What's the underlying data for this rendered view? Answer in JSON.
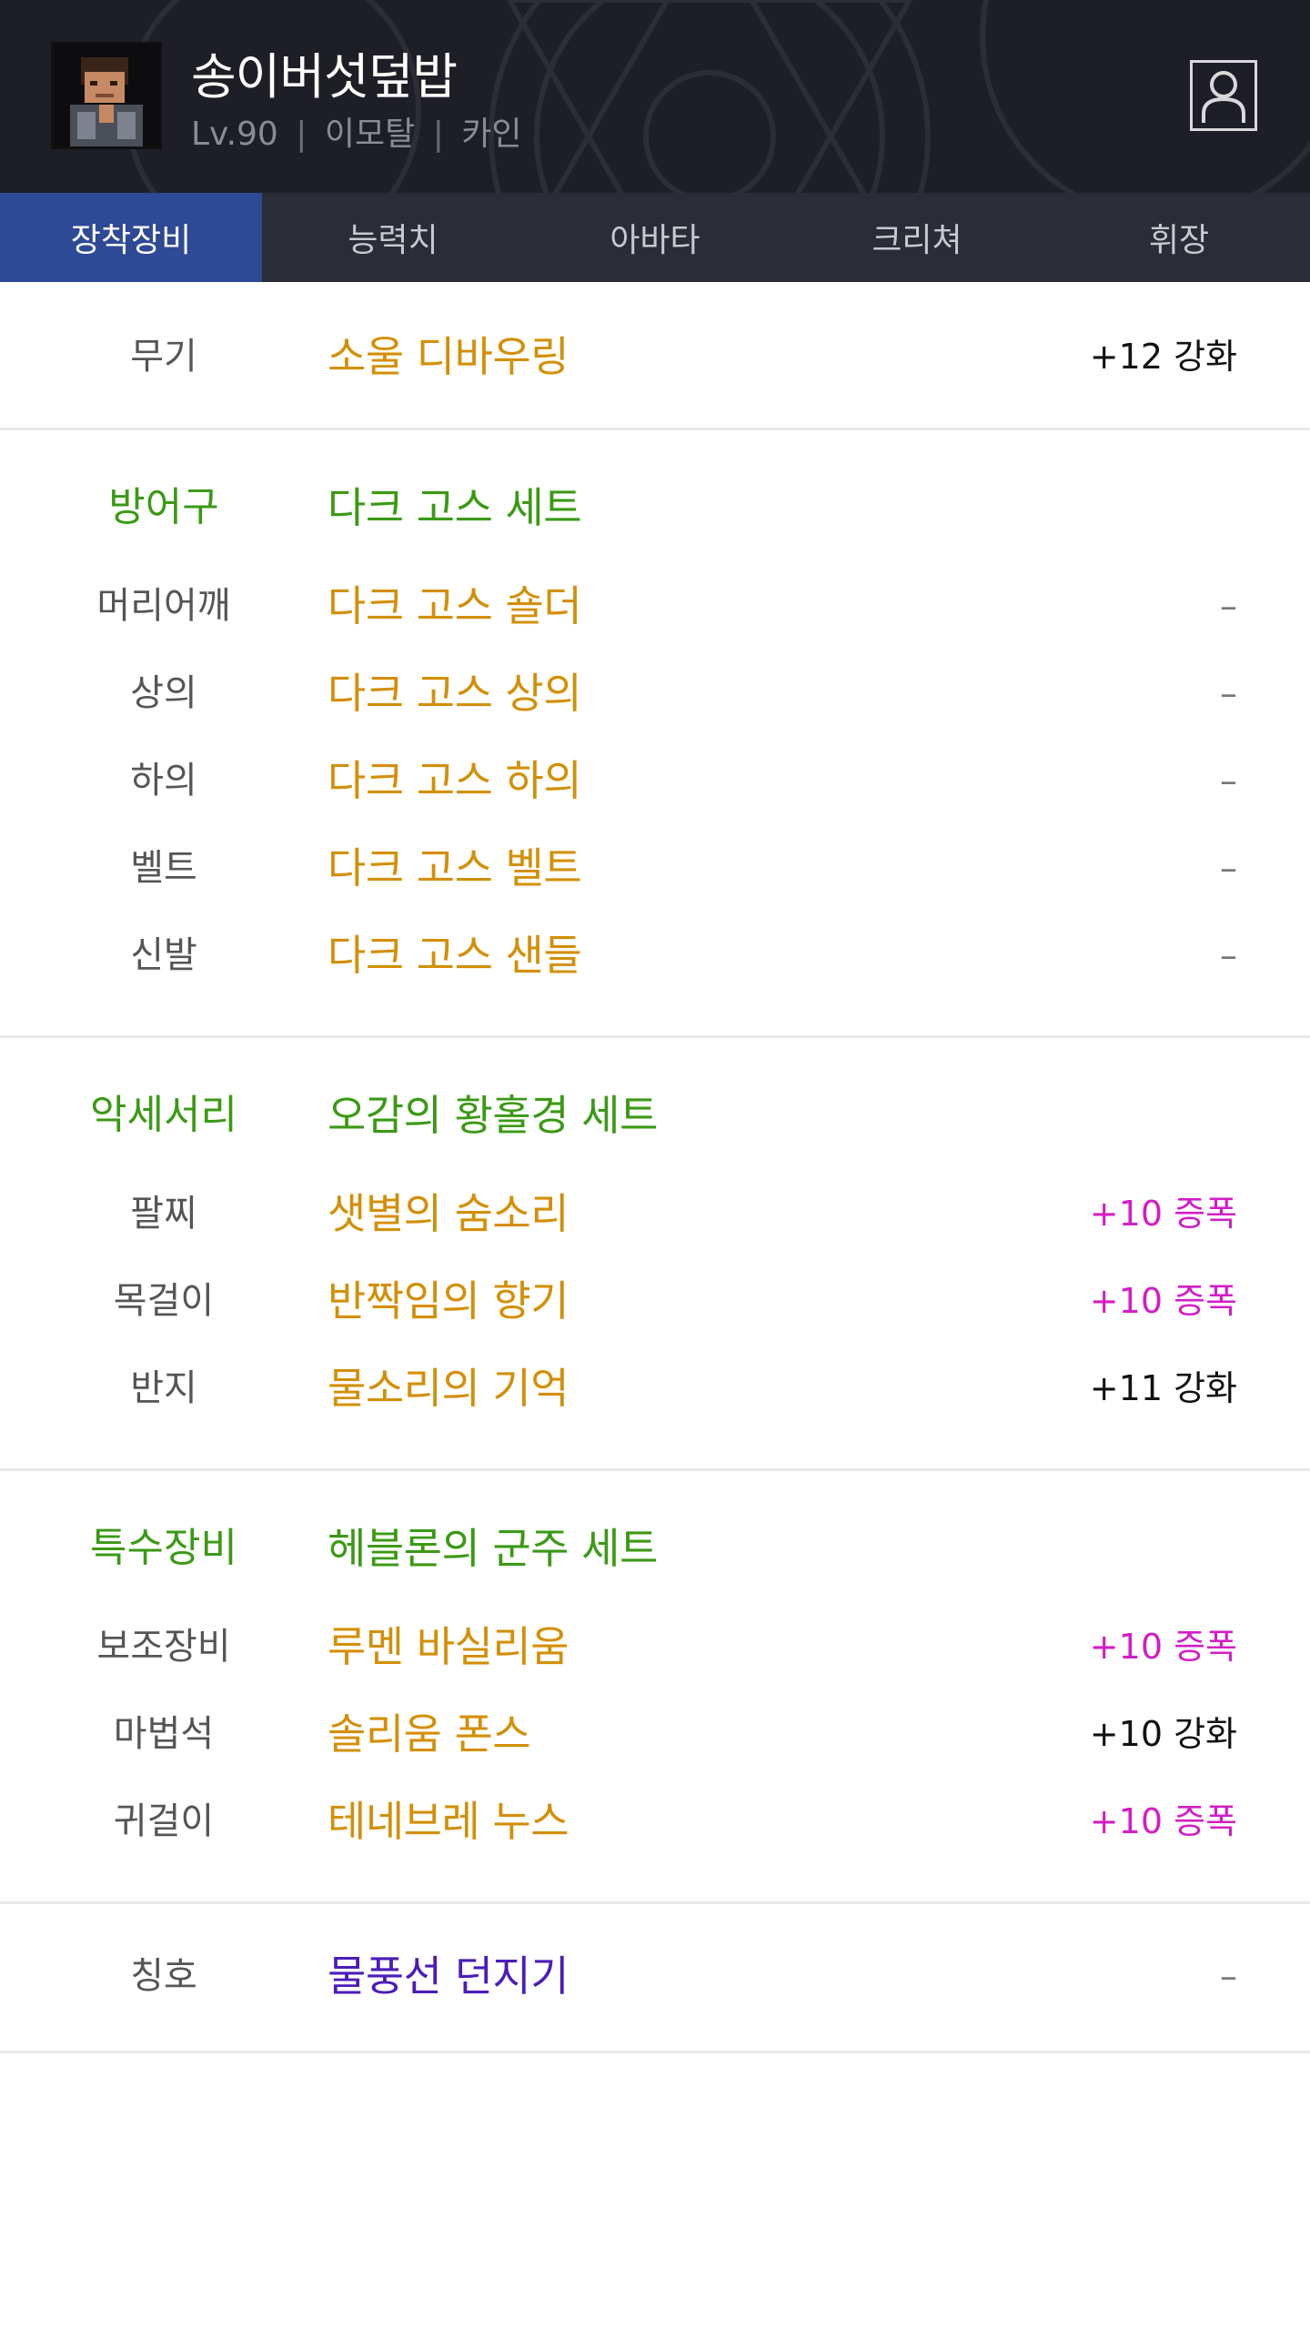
{
  "header": {
    "character_name": "송이버섯덮밥",
    "level": "Lv.90",
    "separator": "|",
    "server": "이모탈",
    "job": "카인"
  },
  "tabs": [
    {
      "label": "장착장비",
      "active": true
    },
    {
      "label": "능력치",
      "active": false
    },
    {
      "label": "아바타",
      "active": false
    },
    {
      "label": "크리쳐",
      "active": false
    },
    {
      "label": "휘장",
      "active": false
    }
  ],
  "weapon": {
    "slot": "무기",
    "item": "소울 디바우링",
    "upgrade": "+12 강화"
  },
  "armor": {
    "group": "방어구",
    "set": "다크 고스 세트",
    "items": [
      {
        "slot": "머리어깨",
        "item": "다크 고스 숄더",
        "upgrade": "–"
      },
      {
        "slot": "상의",
        "item": "다크 고스 상의",
        "upgrade": "–"
      },
      {
        "slot": "하의",
        "item": "다크 고스 하의",
        "upgrade": "–"
      },
      {
        "slot": "벨트",
        "item": "다크 고스 벨트",
        "upgrade": "–"
      },
      {
        "slot": "신발",
        "item": "다크 고스 샌들",
        "upgrade": "–"
      }
    ]
  },
  "accessory": {
    "group": "악세서리",
    "set": "오감의 황홀경 세트",
    "items": [
      {
        "slot": "팔찌",
        "item": "샛별의 숨소리",
        "upgrade": "+10 증폭"
      },
      {
        "slot": "목걸이",
        "item": "반짝임의 향기",
        "upgrade": "+10 증폭"
      },
      {
        "slot": "반지",
        "item": "물소리의 기억",
        "upgrade": "+11 강화"
      }
    ]
  },
  "special": {
    "group": "특수장비",
    "set": "헤블론의 군주 세트",
    "items": [
      {
        "slot": "보조장비",
        "item": "루멘 바실리움",
        "upgrade": "+10 증폭"
      },
      {
        "slot": "마법석",
        "item": "솔리움 폰스",
        "upgrade": "+10 강화"
      },
      {
        "slot": "귀걸이",
        "item": "테네브레 누스",
        "upgrade": "+10 증폭"
      }
    ]
  },
  "title_slot": {
    "slot": "칭호",
    "item": "물풍선 던지기",
    "upgrade": "–"
  },
  "colors": {
    "item_orange": "#d38f07",
    "set_green": "#3a9a14",
    "amp_magenta": "#d21ec6",
    "title_purple": "#4c1cb8",
    "tab_active": "#2e4a96",
    "header_bg": "#1e1f26"
  },
  "icons": {
    "profile": "person-icon",
    "avatar": "character-portrait"
  }
}
